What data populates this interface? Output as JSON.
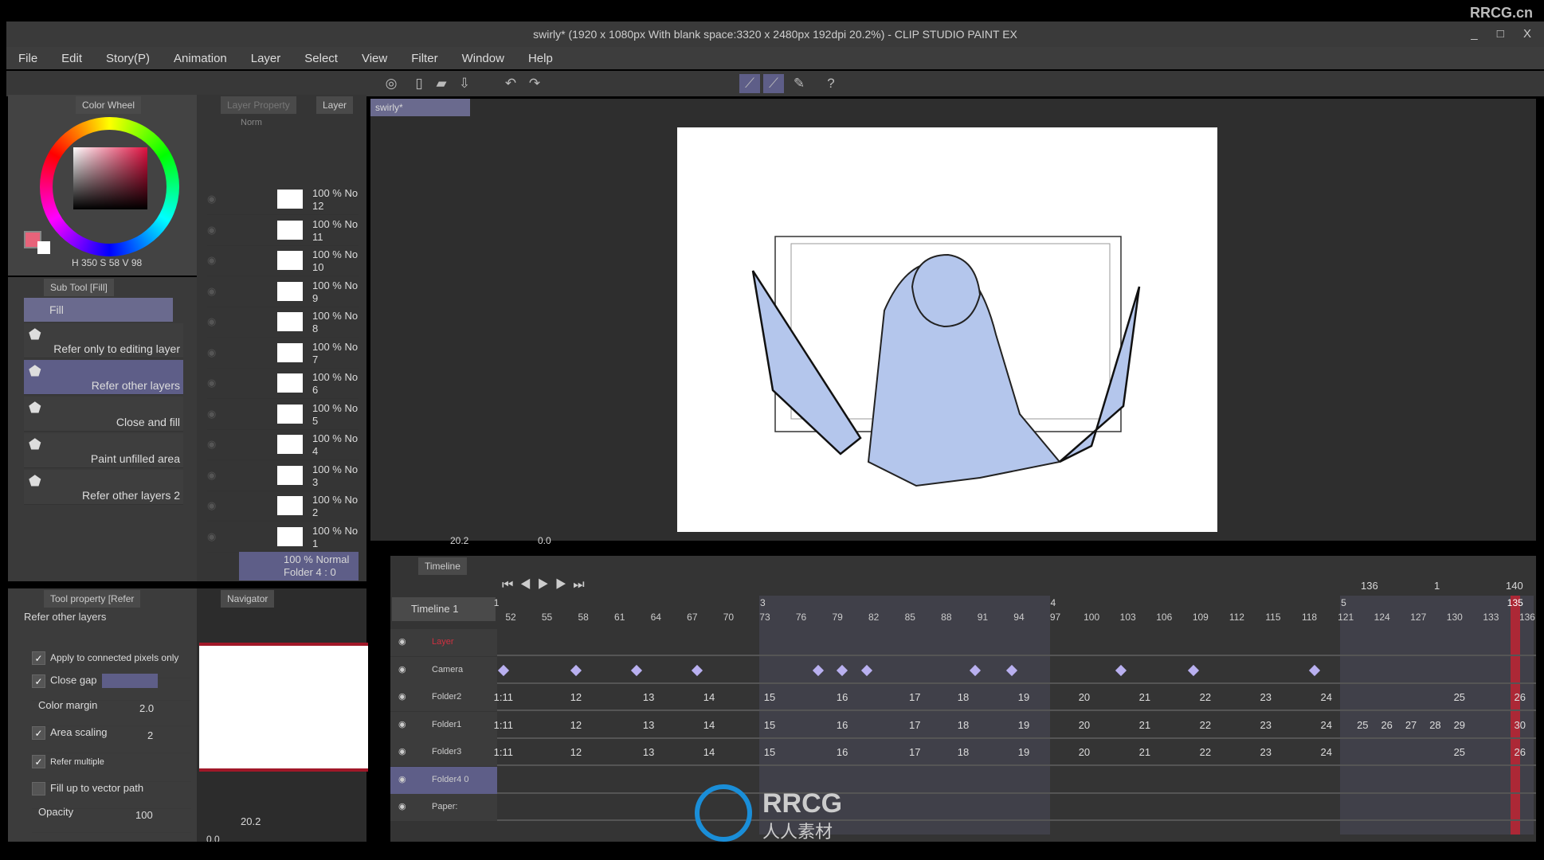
{
  "brand": "RRCG.cn",
  "title": "swirly* (1920 x 1080px With blank space:3320 x 2480px 192dpi 20.2%)  - CLIP STUDIO PAINT EX",
  "window_controls": "_ □ X",
  "menu": [
    "File",
    "Edit",
    "Story(P)",
    "Animation",
    "Layer",
    "Select",
    "View",
    "Filter",
    "Window",
    "Help"
  ],
  "toolbar_icons": [
    "app-icon",
    "new-icon",
    "open-icon",
    "save-icon",
    "undo-icon",
    "redo-icon",
    "help-icon"
  ],
  "doc_tab": {
    "label": "swirly*"
  },
  "color_wheel": {
    "tab": "Color Wheel",
    "h_label": "H",
    "h": "350",
    "s_label": "S",
    "s": "58",
    "v_label": "V",
    "v": "98",
    "main_color": "#e8637a",
    "sub_color": "#ffffff"
  },
  "sub_tool": {
    "tab": "Sub Tool [Fill]",
    "group": "Fill",
    "items": [
      {
        "label": "Refer only to editing layer"
      },
      {
        "label": "Refer other layers",
        "selected": true
      },
      {
        "label": "Close and fill"
      },
      {
        "label": "Paint unfilled area"
      },
      {
        "label": "Refer other layers 2"
      }
    ]
  },
  "layer_panel": {
    "tab_property": "Layer Property",
    "tab_layer": "Layer",
    "blend": "Norm",
    "layers": [
      {
        "opacity": "100 % No",
        "name": "12"
      },
      {
        "opacity": "100 % No",
        "name": "11"
      },
      {
        "opacity": "100 % No",
        "name": "10"
      },
      {
        "opacity": "100 % No",
        "name": "9"
      },
      {
        "opacity": "100 % No",
        "name": "8"
      },
      {
        "opacity": "100 % No",
        "name": "7"
      },
      {
        "opacity": "100 % No",
        "name": "6"
      },
      {
        "opacity": "100 % No",
        "name": "5"
      },
      {
        "opacity": "100 % No",
        "name": "4"
      },
      {
        "opacity": "100 % No",
        "name": "3"
      },
      {
        "opacity": "100 % No",
        "name": "2"
      },
      {
        "opacity": "100 % No",
        "name": "1"
      }
    ],
    "selected": {
      "opacity": "100 % Normal",
      "name": "Folder 4 : 0"
    }
  },
  "tool_property": {
    "tab": "Tool property [Refer",
    "preset": "Refer other layers",
    "apply_connected": "Apply to connected pixels only",
    "close_gap": "Close gap",
    "color_margin": "Color margin",
    "color_margin_val": "2.0",
    "area_scaling": "Area scaling",
    "area_scaling_val": "2",
    "refer_multiple": "Refer multiple",
    "fill_vector": "Fill up to vector path",
    "opacity": "Opacity",
    "opacity_val": "100"
  },
  "navigator": {
    "tab": "Navigator",
    "zoom": "20.2",
    "angle": "0.0"
  },
  "canvas_status": {
    "zoom": "20.2",
    "angle": "0.0"
  },
  "timeline": {
    "tab": "Timeline",
    "name": "Timeline 1",
    "current": "136",
    "start": "1",
    "end": "140",
    "playhead": "135",
    "sections": [
      {
        "frame": 51,
        "label": "1"
      },
      {
        "frame": 73,
        "label": "3"
      },
      {
        "frame": 97,
        "label": "4"
      },
      {
        "frame": 121,
        "label": "5"
      }
    ],
    "shaded": [
      [
        73,
        97
      ],
      [
        121,
        137
      ]
    ],
    "ticks": [
      52,
      55,
      58,
      61,
      64,
      67,
      70,
      73,
      76,
      79,
      82,
      85,
      88,
      91,
      94,
      97,
      100,
      103,
      106,
      109,
      112,
      115,
      118,
      121,
      124,
      127,
      130,
      133,
      136
    ],
    "tracks": [
      {
        "name": "Layer",
        "color": "#d03040",
        "marks": []
      },
      {
        "name": "Camera",
        "keyframes": [
          51,
          57,
          62,
          67,
          77,
          79,
          81,
          90,
          93,
          102,
          108,
          118
        ]
      },
      {
        "name": "Folder2",
        "marks": [
          [
            51,
            "1:11"
          ],
          [
            57,
            "12"
          ],
          [
            63,
            "13"
          ],
          [
            68,
            "14"
          ],
          [
            73,
            "15"
          ],
          [
            79,
            "16"
          ],
          [
            85,
            "17"
          ],
          [
            89,
            "18"
          ],
          [
            94,
            "19"
          ],
          [
            99,
            "20"
          ],
          [
            104,
            "21"
          ],
          [
            109,
            "22"
          ],
          [
            114,
            "23"
          ],
          [
            119,
            "24"
          ],
          [
            130,
            "25"
          ],
          [
            135,
            "26"
          ]
        ]
      },
      {
        "name": "Folder1",
        "marks": [
          [
            51,
            "1:11"
          ],
          [
            57,
            "12"
          ],
          [
            63,
            "13"
          ],
          [
            68,
            "14"
          ],
          [
            73,
            "15"
          ],
          [
            79,
            "16"
          ],
          [
            85,
            "17"
          ],
          [
            89,
            "18"
          ],
          [
            94,
            "19"
          ],
          [
            99,
            "20"
          ],
          [
            104,
            "21"
          ],
          [
            109,
            "22"
          ],
          [
            114,
            "23"
          ],
          [
            119,
            "24"
          ],
          [
            122,
            "25"
          ],
          [
            124,
            "26"
          ],
          [
            126,
            "27"
          ],
          [
            128,
            "28"
          ],
          [
            130,
            "29"
          ],
          [
            135,
            "30"
          ]
        ]
      },
      {
        "name": "Folder3",
        "marks": [
          [
            51,
            "1:11"
          ],
          [
            57,
            "12"
          ],
          [
            63,
            "13"
          ],
          [
            68,
            "14"
          ],
          [
            73,
            "15"
          ],
          [
            79,
            "16"
          ],
          [
            85,
            "17"
          ],
          [
            89,
            "18"
          ],
          [
            94,
            "19"
          ],
          [
            99,
            "20"
          ],
          [
            104,
            "21"
          ],
          [
            109,
            "22"
          ],
          [
            114,
            "23"
          ],
          [
            119,
            "24"
          ],
          [
            130,
            "25"
          ],
          [
            135,
            "26"
          ]
        ]
      },
      {
        "name": "Folder4 0",
        "marks": [],
        "selected": true
      },
      {
        "name": "Paper:",
        "marks": []
      }
    ]
  },
  "watermark": {
    "en": "RRCG",
    "cn": "人人素材"
  },
  "colors": {
    "accent": "#6b6b9a",
    "keyframe": "#b9b0f0",
    "playhead": "#d02030",
    "fill": "#b4c6ec"
  }
}
